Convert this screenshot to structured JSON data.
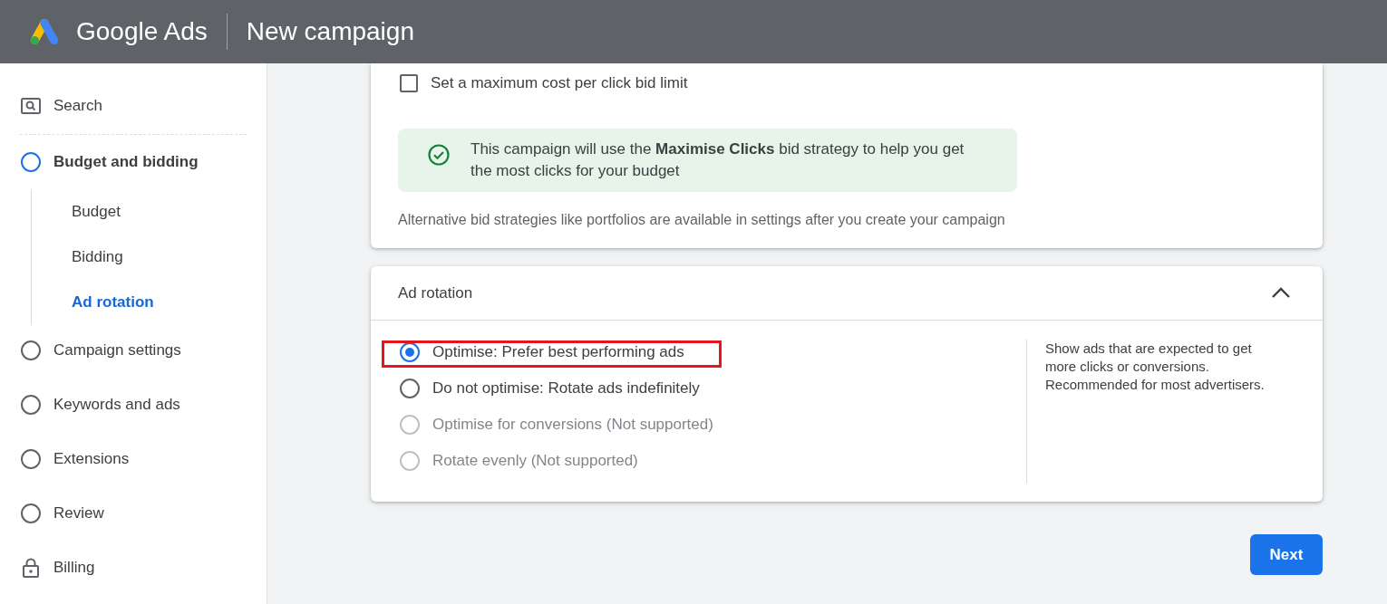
{
  "header": {
    "product": "Google Ads",
    "title": "New campaign"
  },
  "sidebar": {
    "items": [
      {
        "label": "Search",
        "kind": "search",
        "selected": false
      },
      {
        "label": "Budget and bidding",
        "kind": "step",
        "selected": true,
        "children": [
          {
            "label": "Budget",
            "selected": false
          },
          {
            "label": "Bidding",
            "selected": false
          },
          {
            "label": "Ad rotation",
            "selected": true
          }
        ]
      },
      {
        "label": "Campaign settings",
        "kind": "step",
        "selected": false
      },
      {
        "label": "Keywords and ads",
        "kind": "step",
        "selected": false
      },
      {
        "label": "Extensions",
        "kind": "step",
        "selected": false
      },
      {
        "label": "Review",
        "kind": "step",
        "selected": false
      },
      {
        "label": "Billing",
        "kind": "lock",
        "selected": false
      }
    ]
  },
  "bidding": {
    "max_cpc": {
      "label": "Set a maximum cost per click bid limit",
      "checked": false
    },
    "notice": "This campaign will use the **Maximise Clicks** bid strategy to help you get the most clicks for your budget",
    "note": "Alternative bid strategies like portfolios are available in settings after you create your campaign"
  },
  "ad_rotation": {
    "title": "Ad rotation",
    "expanded": true,
    "options": [
      {
        "label": "Optimise: Prefer best performing ads",
        "selected": true,
        "disabled": false,
        "annotated": true
      },
      {
        "label": "Do not optimise: Rotate ads indefinitely",
        "selected": false,
        "disabled": false,
        "annotated": false
      },
      {
        "label": "Optimise for conversions (Not supported)",
        "selected": false,
        "disabled": true,
        "annotated": false
      },
      {
        "label": "Rotate evenly (Not supported)",
        "selected": false,
        "disabled": true,
        "annotated": false
      }
    ],
    "description": "Show ads that are expected to get more clicks or conversions. Recommended for most advertisers."
  },
  "next_button": "Next"
}
